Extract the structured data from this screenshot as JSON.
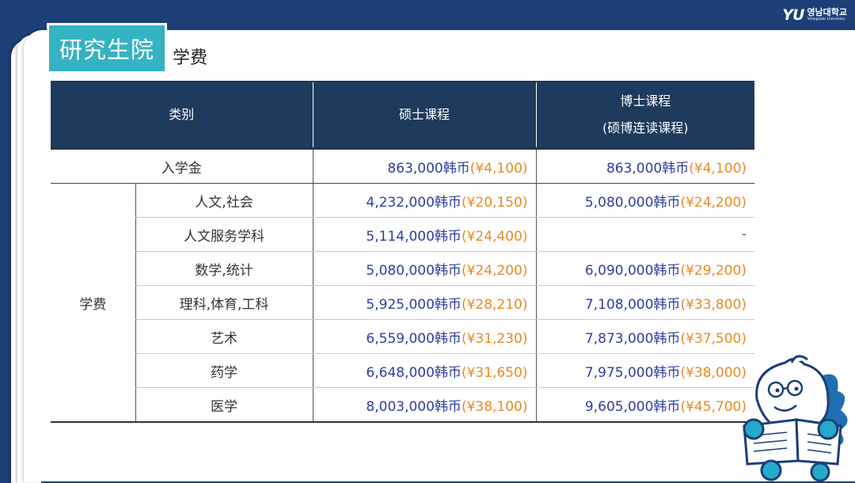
{
  "logo": {
    "mark": "YU",
    "name": "영남대학교",
    "sub": "Yeungnam University"
  },
  "title": "研究生院",
  "subtitle": "学费",
  "table": {
    "headers": {
      "category": "类别",
      "master": "硕士课程",
      "doctor_line1": "博士课程",
      "doctor_line2": "(硕博连读课程)"
    },
    "entry": {
      "label": "入学金",
      "master_krw": "863,000韩币",
      "master_cny": "(¥4,100)",
      "doctor_krw": "863,000韩币",
      "doctor_cny": "(¥4,100)"
    },
    "tuition_label": "学费",
    "rows": [
      {
        "field": "人文,社会",
        "master_krw": "4,232,000韩币",
        "master_cny": "(¥20,150)",
        "doctor_krw": "5,080,000韩币",
        "doctor_cny": "(¥24,200)"
      },
      {
        "field": "人文服务学科",
        "master_krw": "5,114,000韩币",
        "master_cny": "(¥24,400)",
        "doctor_krw": "",
        "doctor_cny": "-"
      },
      {
        "field": "数学,统计",
        "master_krw": "5,080,000韩币",
        "master_cny": "(¥24,200)",
        "doctor_krw": "6,090,000韩币",
        "doctor_cny": "(¥29,200)"
      },
      {
        "field": "理科,体育,工科",
        "master_krw": "5,925,000韩币",
        "master_cny": "(¥28,210)",
        "doctor_krw": "7,108,000韩币",
        "doctor_cny": "(¥33,800)"
      },
      {
        "field": "艺术",
        "master_krw": "6,559,000韩币",
        "master_cny": "(¥31,230)",
        "doctor_krw": "7,873,000韩币",
        "doctor_cny": "(¥37,500)"
      },
      {
        "field": "药学",
        "master_krw": "6,648,000韩币",
        "master_cny": "(¥31,650)",
        "doctor_krw": "7,975,000韩币",
        "doctor_cny": "(¥38,000)"
      },
      {
        "field": "医学",
        "master_krw": "8,003,000韩币",
        "master_cny": "(¥38,100)",
        "doctor_krw": "9,605,000韩币",
        "doctor_cny": "(¥45,700)"
      }
    ]
  },
  "colors": {
    "navy": "#1c3f78",
    "header": "#1e3a5c",
    "teal": "#34b3c3",
    "orange": "#e98a1e",
    "blue_text": "#2f3da0"
  },
  "icons": {
    "mascot": "reading-horse-mascot-icon"
  }
}
